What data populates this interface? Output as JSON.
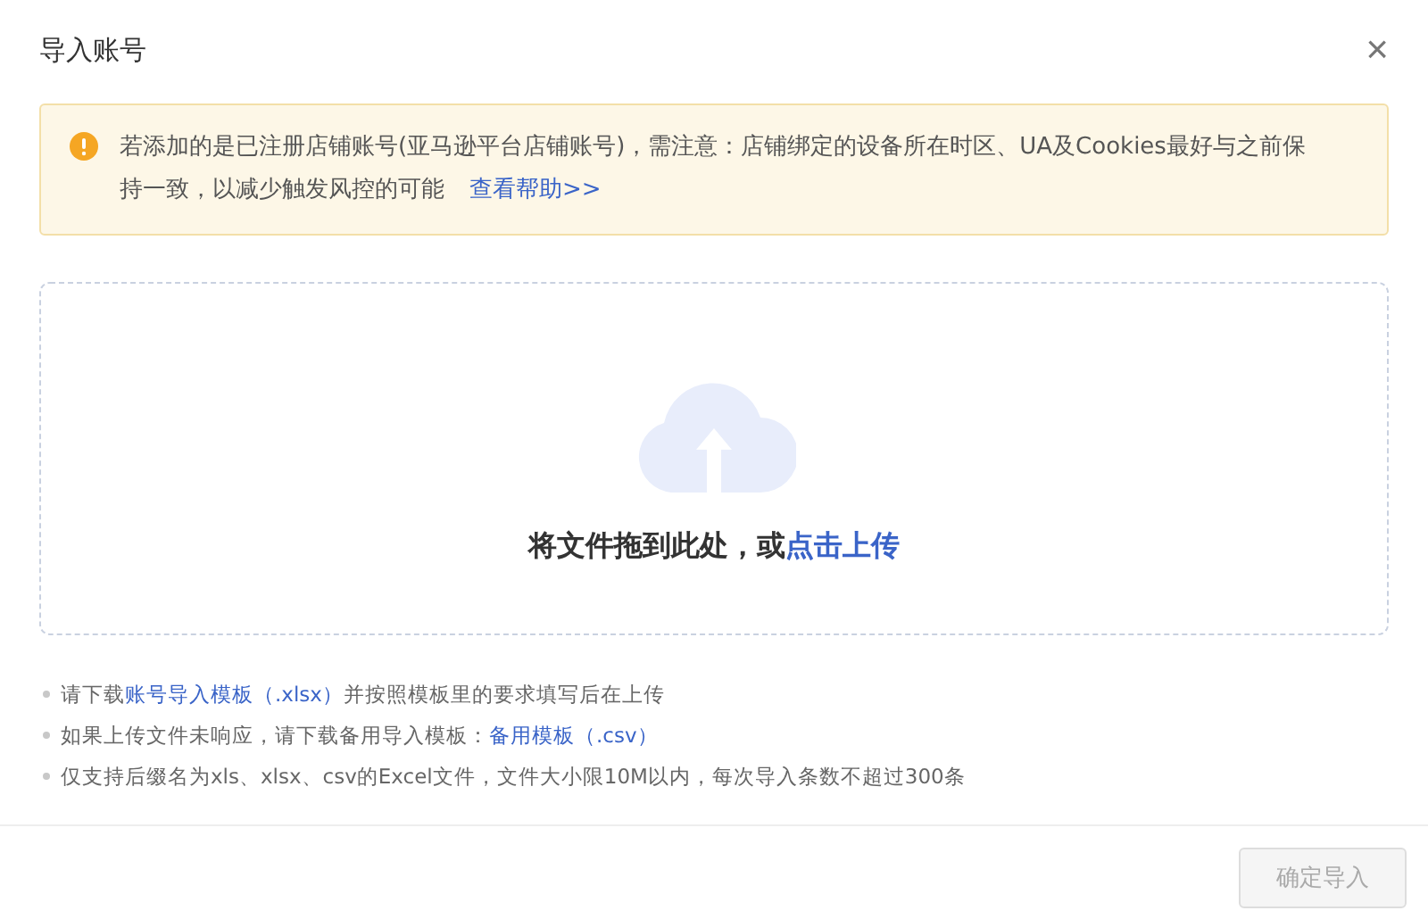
{
  "dialog": {
    "title": "导入账号",
    "close": "×"
  },
  "alert": {
    "text": "若添加的是已注册店铺账号(亚马逊平台店铺账号)，需注意：店铺绑定的设备所在时区、UA及Cookies最好与之前保持一致，以减少触发风控的可能",
    "link": "查看帮助>>"
  },
  "upload": {
    "text": "将文件拖到此处，或",
    "link": "点击上传"
  },
  "notes": [
    [
      {
        "kind": "text",
        "text": "请下载"
      },
      {
        "kind": "link",
        "text": "账号导入模板（.xlsx）"
      },
      {
        "kind": "text",
        "text": "并按照模板里的要求填写后在上传"
      }
    ],
    [
      {
        "kind": "text",
        "text": "如果上传文件未响应，请下载备用导入模板："
      },
      {
        "kind": "link",
        "text": "备用模板（.csv）"
      }
    ],
    [
      {
        "kind": "text",
        "text": "仅支持后缀名为xls、xlsx、csv的Excel文件，文件大小限10M以内，每次导入条数不超过300条"
      }
    ]
  ],
  "confirm": {
    "label": "确定导入",
    "disabled": true
  }
}
